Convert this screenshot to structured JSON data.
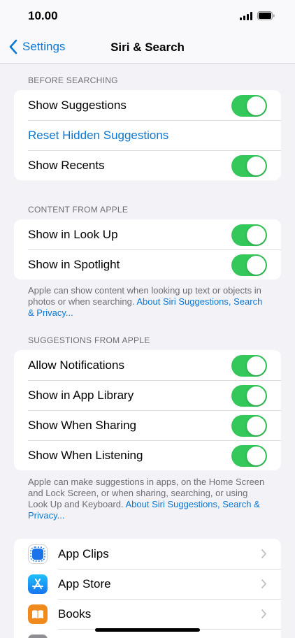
{
  "status": {
    "time": "10.00"
  },
  "nav": {
    "back_label": "Settings",
    "title": "Siri & Search"
  },
  "before_searching": {
    "header": "BEFORE SEARCHING",
    "rows": [
      {
        "label": "Show Suggestions",
        "toggle": true
      },
      {
        "label": "Reset Hidden Suggestions"
      },
      {
        "label": "Show Recents",
        "toggle": true
      }
    ]
  },
  "content_from_apple": {
    "header": "CONTENT FROM APPLE",
    "rows": [
      {
        "label": "Show in Look Up",
        "toggle": true
      },
      {
        "label": "Show in Spotlight",
        "toggle": true
      }
    ],
    "footer": {
      "text": "Apple can show content when looking up text or objects in photos or when searching.",
      "link": "About Siri Suggestions, Search & Privacy..."
    }
  },
  "suggestions_from_apple": {
    "header": "SUGGESTIONS FROM APPLE",
    "rows": [
      {
        "label": "Allow Notifications",
        "toggle": true
      },
      {
        "label": "Show in App Library",
        "toggle": true
      },
      {
        "label": "Show When Sharing",
        "toggle": true
      },
      {
        "label": "Show When Listening",
        "toggle": true
      }
    ],
    "footer": {
      "text": "Apple can make suggestions in apps, on the Home Screen and Lock Screen, or when sharing, searching, or using Look Up and Keyboard.",
      "link": "About Siri Suggestions, Search & Privacy..."
    }
  },
  "apps": [
    {
      "label": "App Clips",
      "icon": "app-clips-icon"
    },
    {
      "label": "App Store",
      "icon": "app-store-icon"
    },
    {
      "label": "Books",
      "icon": "books-icon"
    }
  ],
  "colors": {
    "accent": "#0a78d4",
    "toggle_on": "#34c759",
    "background": "#f2f2f7"
  }
}
